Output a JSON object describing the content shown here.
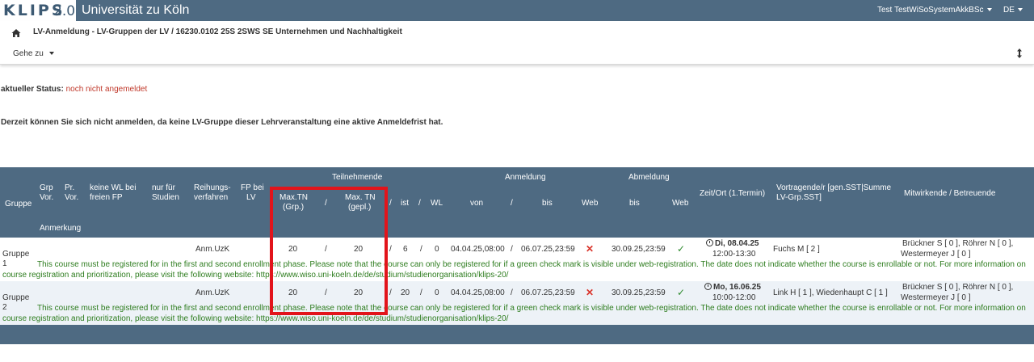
{
  "header": {
    "logo": "KLIPS",
    "logo_version": "2.0",
    "university": "Universität zu Köln",
    "user": "Test TestWiSoSystemAkkBSc",
    "language": "DE"
  },
  "breadcrumb": {
    "title": "LV-Anmeldung - LV-Gruppen der LV / 16230.0102 25S 2SWS SE Unternehmen und Nachhaltigkeit",
    "goto": "Gehe zu"
  },
  "status": {
    "label": "aktueller Status:",
    "value": "noch nicht angemeldet"
  },
  "notice": "Derzeit können Sie sich nicht anmelden, da keine LV-Gruppe dieser Lehrveranstaltung eine aktive Anmeldefrist hat.",
  "table": {
    "headers": {
      "gruppe": "Gruppe",
      "grp_vor_1": "Grp",
      "grp_vor_2": "Vor.",
      "pr_vor_1": "Pr.",
      "pr_vor_2": "Vor.",
      "keine_wl_1": "keine WL bei",
      "keine_wl_2": "freien FP",
      "nur_fuer_1": "nur für",
      "nur_fuer_2": "Studien",
      "reihung_1": "Reihungs-",
      "reihung_2": "verfahren",
      "fp_1": "FP bei",
      "fp_2": "LV",
      "teilnehmende": "Teilnehmende",
      "max_grp_1": "Max.TN",
      "max_grp_2": "(Grp.)",
      "slash": "/",
      "max_gepl_1": "Max. TN",
      "max_gepl_2": "(gepl.)",
      "ist": "ist",
      "wl": "WL",
      "anmeldung": "Anmeldung",
      "von": "von",
      "bis": "bis",
      "web": "Web",
      "abmeldung": "Abmeldung",
      "zeit_ort": "Zeit/Ort (1.Termin)",
      "vortragende_1": "Vortragende/r [gen.SST|Summe",
      "vortragende_2": "LV-Grp.SST]",
      "mitwirkende": "Mitwirkende / Betreuende",
      "anmerkung": "Anmerkung"
    },
    "rows": [
      {
        "gruppe_1": "Gruppe",
        "gruppe_2": "1",
        "reihung": "Anm.UzK",
        "max_grp": "20",
        "max_gepl": "20",
        "ist": "6",
        "wl": "0",
        "anm_von": "04.04.25,08:00",
        "anm_bis": "06.07.25,23:59",
        "anm_web": "✕",
        "abm_bis": "30.09.25,23:59",
        "abm_web": "✓",
        "date": "Di, 08.04.25",
        "time": "12:00-13:30",
        "vortragende": "Fuchs M [ 2 ]",
        "mitwirkende_1": "Brückner S [ 0 ], Röhrer N [ 0 ],",
        "mitwirkende_2": "Westermeyer J [ 0 ]",
        "remark_1": "This course must be registered for in the first and second enrollment phase. Please note that the course can only be registered for if a green check mark is visible under web-registration. The date does not indicate whether the course is enrollable or not. For more information on",
        "remark_2": "course registration and prioritization, please visit the following website: https://www.wiso.uni-koeln.de/de/studium/studienorganisation/klips-20/"
      },
      {
        "gruppe_1": "Gruppe",
        "gruppe_2": "2",
        "reihung": "Anm.UzK",
        "max_grp": "20",
        "max_gepl": "20",
        "ist": "20",
        "wl": "0",
        "anm_von": "04.04.25,08:00",
        "anm_bis": "06.07.25,23:59",
        "anm_web": "✕",
        "abm_bis": "30.09.25,23:59",
        "abm_web": "✓",
        "date": "Mo, 16.06.25",
        "time": "10:00-12:00",
        "vortragende": "Link H [ 1 ], Wiedenhaupt C [ 1 ]",
        "mitwirkende_1": "Brückner S [ 0 ], Röhrer N [ 0 ],",
        "mitwirkende_2": "Westermeyer J [ 0 ]",
        "remark_1": "This course must be registered for in the first and second enrollment phase. Please note that the course can only be registered for if a green check mark is visible under web-registration. The date does not indicate whether the course is enrollable or not. For more information on",
        "remark_2": "course registration and prioritization, please visit the following website: https://www.wiso.uni-koeln.de/de/studium/studienorganisation/klips-20/"
      }
    ]
  },
  "colors": {
    "header_bg": "#4e6a82",
    "status_red": "#c0392b",
    "remark_green": "#2e7d1f",
    "highlight_red": "#e2141b"
  }
}
